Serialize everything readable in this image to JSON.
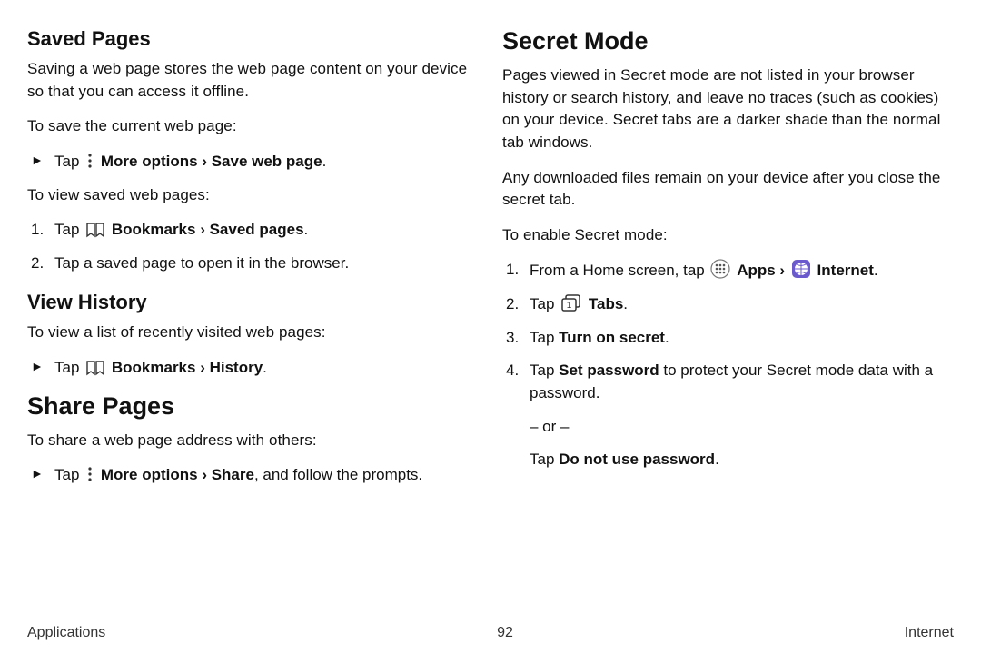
{
  "left": {
    "savedPages": {
      "heading": "Saved Pages",
      "intro": "Saving a web page stores the web page content on your device so that you can access it offline.",
      "toSave": "To save the current web page:",
      "saveStepPre": "Tap ",
      "saveStepBold1": "More options",
      "saveStepBold2": "Save web page",
      "toView": "To view saved web pages:",
      "s1pre": "Tap ",
      "s1bold1": "Bookmarks",
      "s1bold2": "Saved pages",
      "s2": "Tap a saved page to open it in the browser."
    },
    "viewHistory": {
      "heading": "View History",
      "intro": "To view a list of recently visited web pages:",
      "stepPre": "Tap ",
      "stepBold1": "Bookmarks",
      "stepBold2": "History"
    },
    "sharePages": {
      "heading": "Share Pages",
      "intro": "To share a web page address with others:",
      "stepPre": "Tap ",
      "stepBold1": "More options",
      "stepBold2": "Share",
      "stepTail": ", and follow the prompts."
    }
  },
  "right": {
    "secretMode": {
      "heading": "Secret Mode",
      "p1": "Pages viewed in Secret mode are not listed in your browser history or search history, and leave no traces (such as cookies) on your device. Secret tabs are a darker shade than the normal tab windows.",
      "p2": "Any downloaded files remain on your device after you close the secret tab.",
      "toEnable": "To enable Secret mode:",
      "s1pre": "From a Home screen, tap ",
      "s1apps": "Apps",
      "s1internet": "Internet",
      "s2pre": "Tap ",
      "s2bold": "Tabs",
      "s3pre": "Tap ",
      "s3bold": "Turn on secret",
      "s4pre": "Tap ",
      "s4bold1": "Set password",
      "s4tail": " to protect your Secret mode data with a password.",
      "or": "– or –",
      "s4bpre": "Tap ",
      "s4bbold": "Do not use password"
    }
  },
  "footer": {
    "left": "Applications",
    "center": "92",
    "right": "Internet"
  },
  "glyphs": {
    "triangle": "►",
    "chevron": " › ",
    "period": "."
  }
}
